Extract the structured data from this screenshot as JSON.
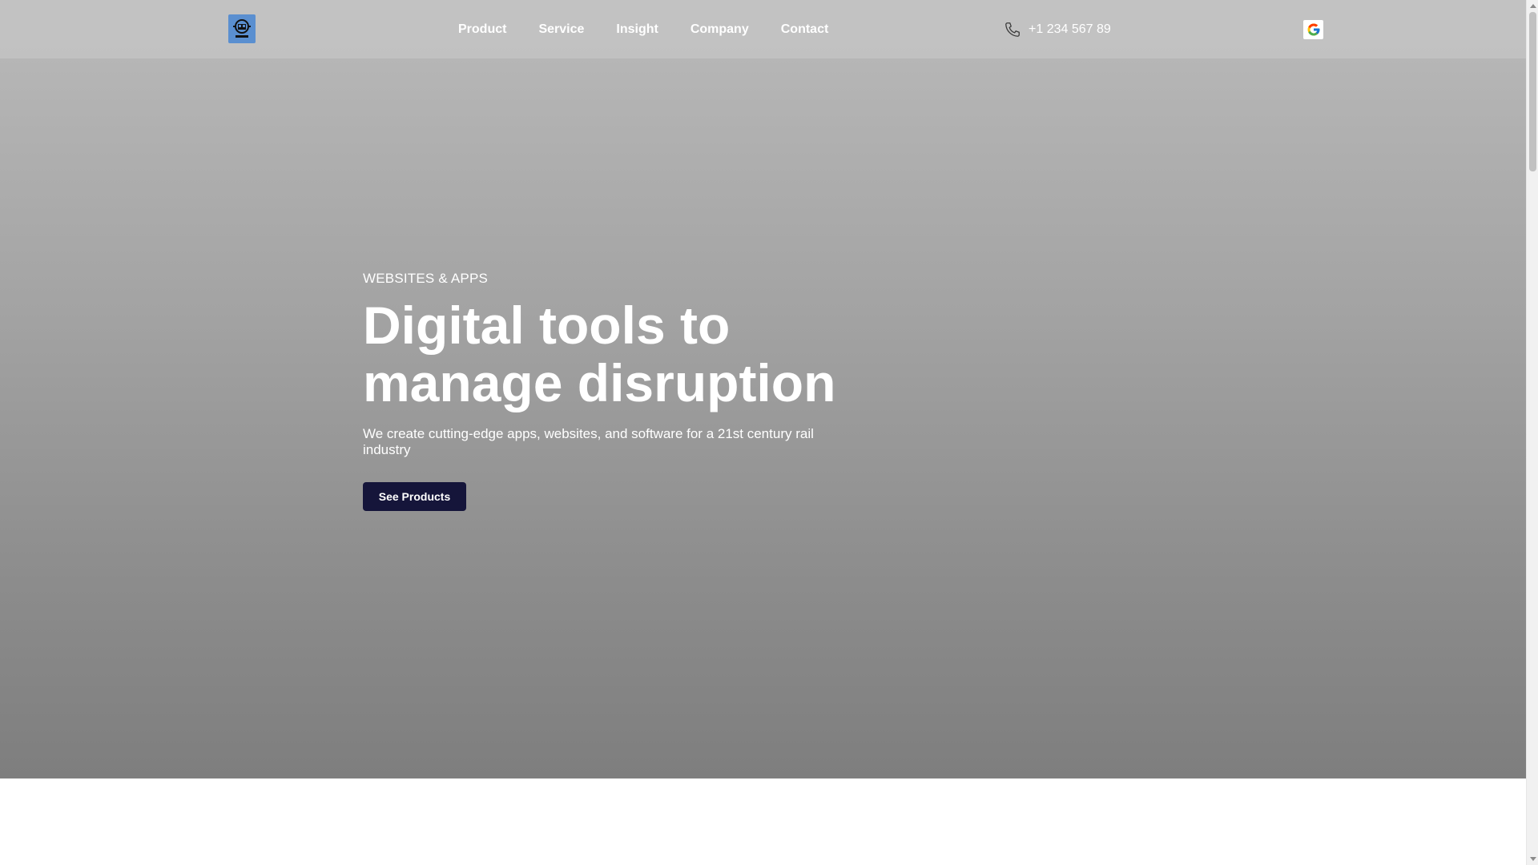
{
  "header": {
    "logo_icon": "train-logo-icon",
    "nav": [
      "Product",
      "Service",
      "Insight",
      "Company",
      "Contact"
    ],
    "phone_icon": "phone-icon",
    "phone": "+1 234 567 89",
    "lang_icon": "google-translate-icon"
  },
  "hero": {
    "eyebrow": "WEBSITES & APPS",
    "headline_line1": "Digital tools to",
    "headline_line2": "manage disruption",
    "subtitle": "We create cutting-edge apps, websites, and software for a 21st century rail industry",
    "cta": "See Products"
  },
  "colors": {
    "cta_background": "#15153a",
    "logo_background": "#5a8fd0",
    "hero_gradient_top": "#bababa",
    "hero_gradient_bottom": "#7e7e7e"
  }
}
